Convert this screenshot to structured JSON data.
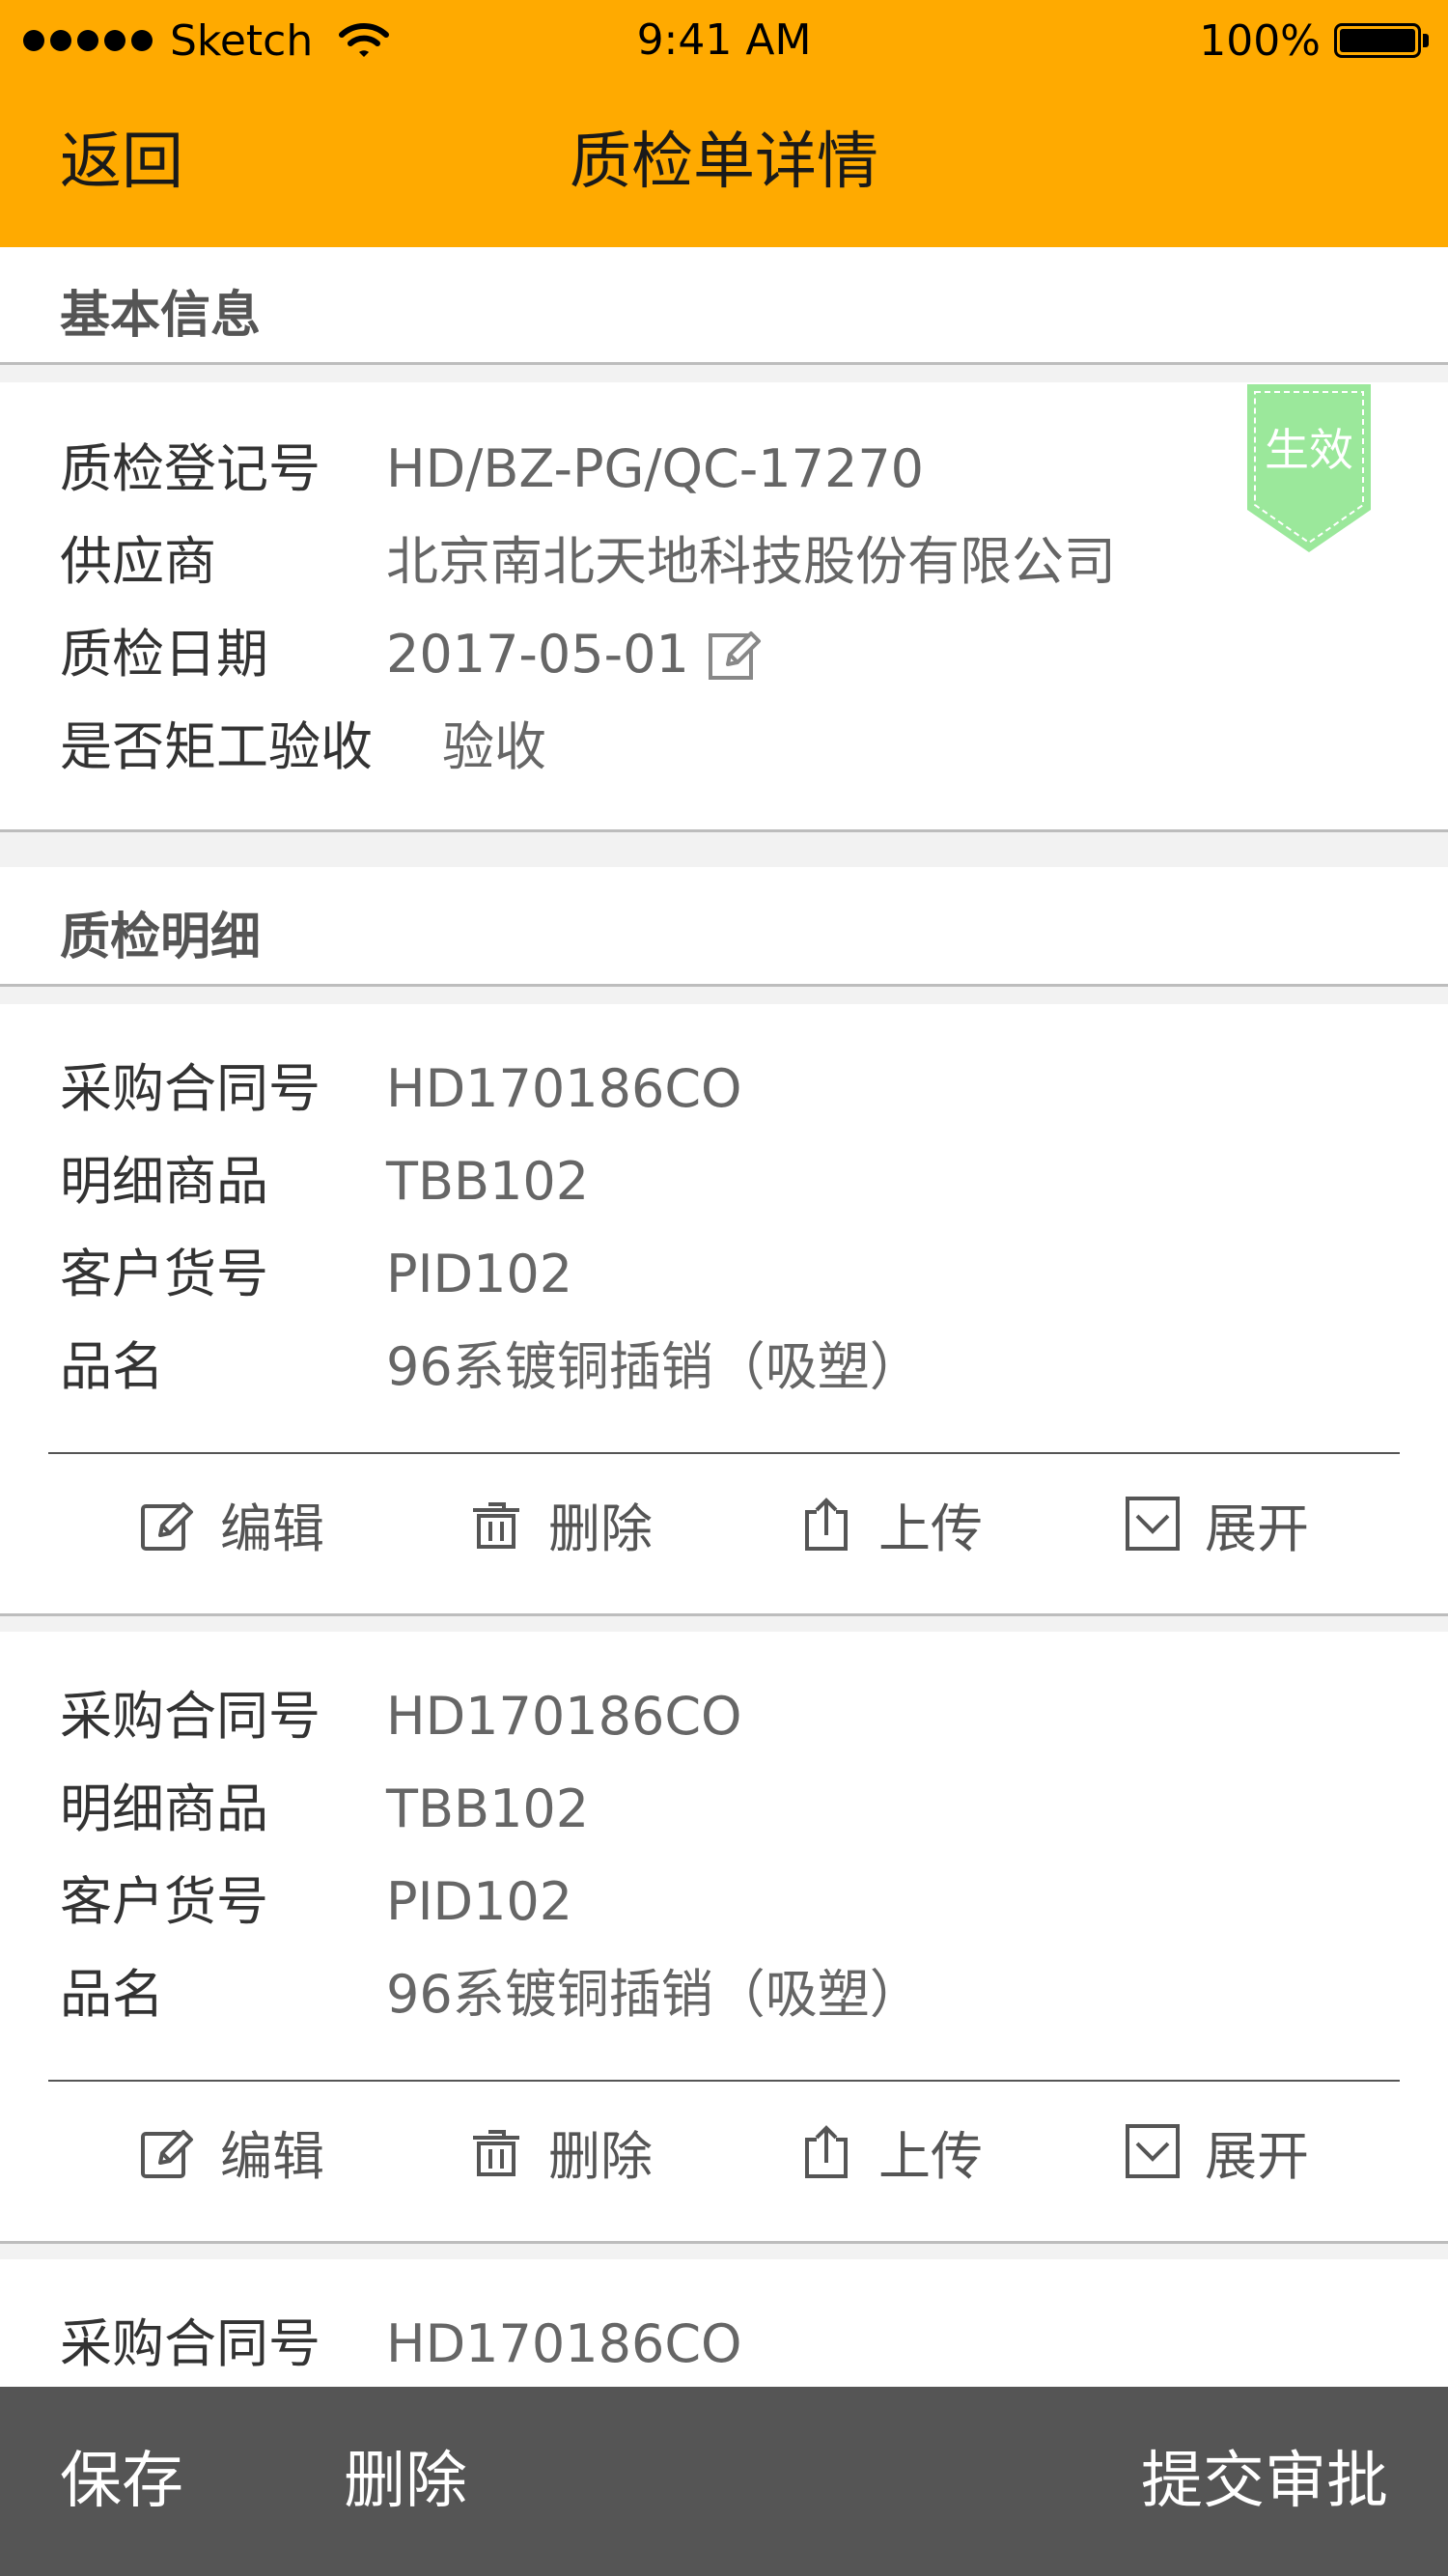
{
  "status_bar": {
    "carrier": "Sketch",
    "time": "9:41 AM",
    "battery": "100%"
  },
  "nav": {
    "back_label": "返回",
    "title": "质检单详情"
  },
  "basic_info": {
    "heading": "基本信息",
    "badge": "生效",
    "fields": [
      {
        "label": "质检登记号",
        "value": "HD/BZ-PG/QC-17270"
      },
      {
        "label": "供应商",
        "value": "北京南北天地科技股份有限公司"
      },
      {
        "label": "质检日期",
        "value": "2017-05-01"
      },
      {
        "label": "是否矩工验收",
        "value": "验收"
      }
    ]
  },
  "details": {
    "heading": "质检明细",
    "labels": {
      "contract": "采购合同号",
      "product": "明细商品",
      "customer_no": "客户货号",
      "name": "品名"
    },
    "items": [
      {
        "contract": "HD170186CO",
        "product": "TBB102",
        "customer_no": "PID102",
        "name": "96系镀铜插销（吸塑）"
      },
      {
        "contract": "HD170186CO",
        "product": "TBB102",
        "customer_no": "PID102",
        "name": "96系镀铜插销（吸塑）"
      },
      {
        "contract": "HD170186CO"
      }
    ],
    "actions": {
      "edit": "编辑",
      "delete": "删除",
      "upload": "上传",
      "expand": "展开"
    }
  },
  "bottom_bar": {
    "save": "保存",
    "delete": "删除",
    "submit": "提交审批"
  },
  "colors": {
    "header": "#ffaa00",
    "badge": "#9be89b",
    "bottom_bar": "#555555"
  },
  "icons": [
    "wifi-icon",
    "battery-icon",
    "edit-icon",
    "trash-icon",
    "upload-icon",
    "expand-icon"
  ]
}
